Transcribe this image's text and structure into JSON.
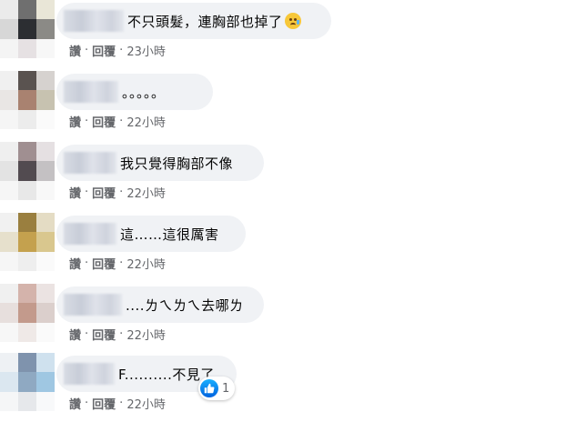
{
  "actions": {
    "like": "讚",
    "reply": "回覆"
  },
  "comments": [
    {
      "text": "不只頭髮，連胸部也掉了",
      "emoji": "sad-tear-emoji",
      "time": "23小時"
    },
    {
      "text": "。。。。。",
      "time": "22小時"
    },
    {
      "text": "我只覺得胸部不像",
      "time": "22小時"
    },
    {
      "text": "這……這很厲害",
      "time": "22小時"
    },
    {
      "text": "....ㄌㄟㄌㄟ去哪ㄌ",
      "time": "22小時"
    },
    {
      "text": "F..........不見了",
      "time": "22小時",
      "reaction_count": "1"
    }
  ],
  "colors": {
    "bubble": "#f0f2f5",
    "meta": "#65676b",
    "like_blue": "#1877f2"
  }
}
